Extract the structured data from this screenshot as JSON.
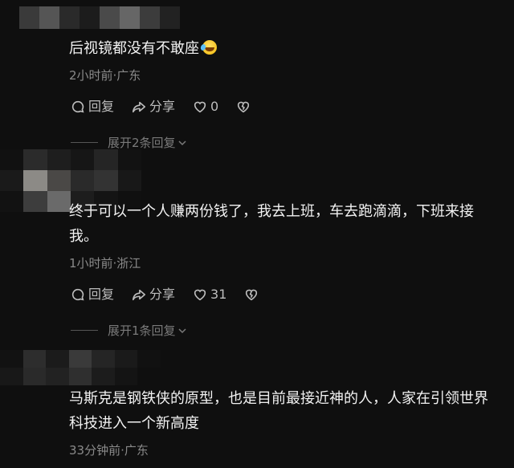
{
  "comments": [
    {
      "text": "后视镜都没有不敢座",
      "emoji": "rofl-emoji",
      "meta": "2小时前·广东",
      "reply_label": "回复",
      "share_label": "分享",
      "likes": "0",
      "expand_label": "展开2条回复"
    },
    {
      "text": "终于可以一个人赚两份钱了，我去上班，车去跑滴滴，下班来接我。",
      "meta": "1小时前·浙江",
      "reply_label": "回复",
      "share_label": "分享",
      "likes": "31",
      "expand_label": "展开1条回复"
    },
    {
      "text": "马斯克是钢铁侠的原型，也是目前最接近神的人，人家在引领世界科技进入一个新高度",
      "meta": "33分钟前·广东"
    }
  ],
  "icons": {
    "reply": "comment-bubble-icon",
    "share": "share-arrow-icon",
    "like": "heart-outline-icon",
    "dislike": "broken-heart-icon",
    "expand": "chevron-down-icon"
  }
}
